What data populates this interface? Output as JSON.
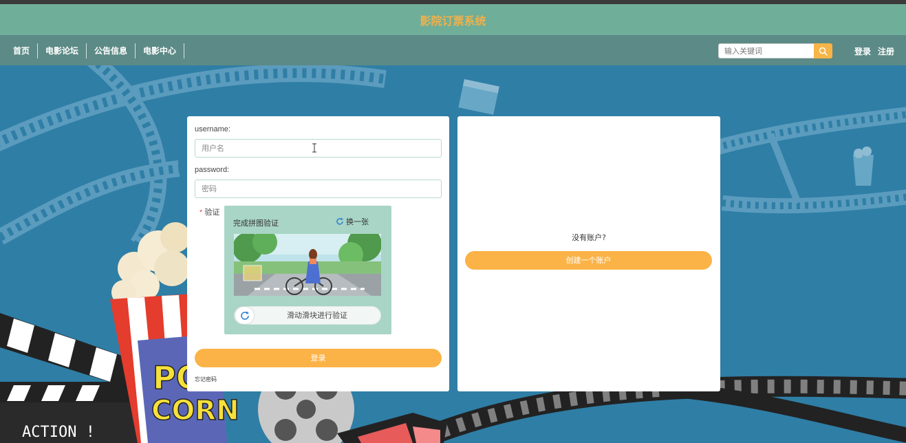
{
  "header": {
    "title": "影院订票系统"
  },
  "nav": {
    "items": [
      "首页",
      "电影论坛",
      "公告信息",
      "电影中心"
    ]
  },
  "search": {
    "placeholder": "输入关键词"
  },
  "auth": {
    "login": "登录",
    "register": "注册"
  },
  "login_form": {
    "username_label": "username:",
    "username_placeholder": "用户名",
    "password_label": "password:",
    "password_placeholder": "密码",
    "verify_required_mark": "*",
    "verify_label": "验证",
    "captcha": {
      "title": "完成拼图验证",
      "refresh_label": "换一张",
      "slider_text": "滑动滑块进行验证"
    },
    "submit_label": "登录",
    "forgot_label": "忘记密码"
  },
  "register_panel": {
    "prompt": "没有账户?",
    "create_label": "创建一个账户"
  },
  "background": {
    "clapper_text": "ACTION !",
    "popcorn_text_1": "PO",
    "popcorn_text_2": "CORN"
  },
  "colors": {
    "title_bar": "#6fae98",
    "title_text": "#f2b04a",
    "nav_bar": "#5c8a86",
    "accent": "#fbb347",
    "background": "#2f7ea6",
    "captcha_bg": "#a8d5c5"
  }
}
